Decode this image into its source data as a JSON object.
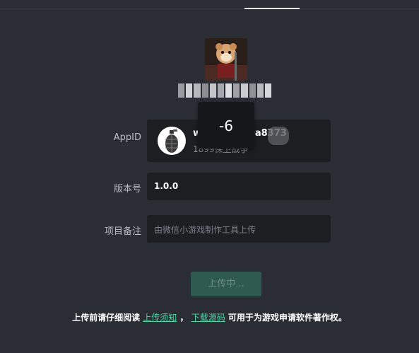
{
  "toast": {
    "text": "-6"
  },
  "form": {
    "appid": {
      "label": "AppID",
      "value": "wxf4cbe0e0a8373",
      "sub": "1899保卫战争"
    },
    "version": {
      "label": "版本号",
      "value": "1.0.0"
    },
    "note": {
      "label": "项目备注",
      "placeholder": "由微信小游戏制作工具上传"
    }
  },
  "upload_button": {
    "label": "上传中..."
  },
  "notice": {
    "prefix": "上传前请仔细阅读",
    "link1": "上传须知",
    "sep": "，",
    "link2": "下载源码",
    "suffix": "可用于为游戏申请软件著作权。"
  },
  "colors": {
    "accent": "#4dd7a7",
    "button_bg": "#2f5a4f",
    "background": "#2b2d34"
  }
}
